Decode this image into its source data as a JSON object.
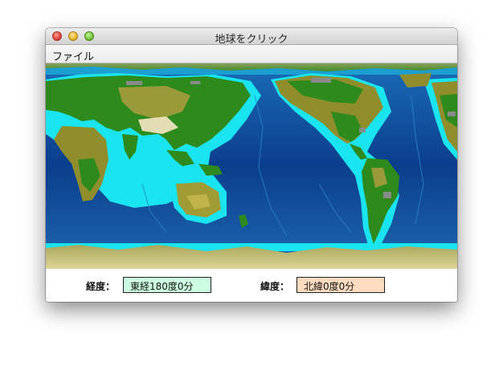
{
  "window": {
    "title": "地球をクリック"
  },
  "menu": {
    "items": [
      "ファイル"
    ]
  },
  "map": {
    "description_icon": "world-map-icon"
  },
  "status": {
    "longitude_label": "経度：",
    "longitude_value": "東経180度0分",
    "latitude_label": "緯度：",
    "latitude_value": "北緯0度0分"
  },
  "colors": {
    "longitude_field_bg": "#ccffe0",
    "latitude_field_bg": "#ffdcc0",
    "ocean_deep": "#0b3e8c",
    "shallow": "#19e4f0",
    "land_low": "#1f8a1a",
    "land_high": "#b5a93a",
    "ice": "#c8c282"
  }
}
